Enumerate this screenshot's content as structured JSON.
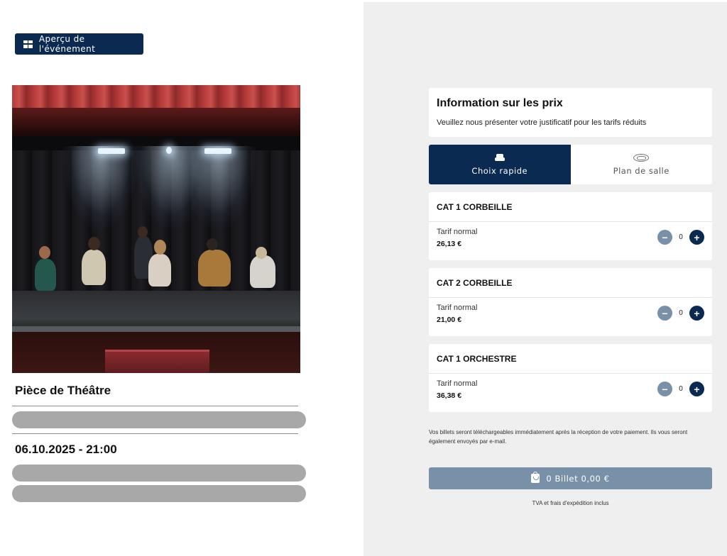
{
  "event": {
    "preview_button_label": "Aperçu de l'événement",
    "title": "Pièce de Théâtre",
    "datetime": "06.10.2025 - 21:00"
  },
  "pricing": {
    "title": "Information sur les prix",
    "subtitle": "Veuillez nous présenter votre justificatif pour les tarifs réduits"
  },
  "tabs": [
    {
      "label": "Choix rapide",
      "icon": "seat-icon",
      "active": true
    },
    {
      "label": "Plan de salle",
      "icon": "seating-plan-icon",
      "active": false
    }
  ],
  "categories": [
    {
      "name": "CAT 1 CORBEILLE",
      "tariff": "Tarif normal",
      "price": "26,13 €",
      "quantity": "0"
    },
    {
      "name": "CAT 2 CORBEILLE",
      "tariff": "Tarif normal",
      "price": "21,00 €",
      "quantity": "0"
    },
    {
      "name": "CAT 1 ORCHESTRE",
      "tariff": "Tarif normal",
      "price": "36,38 €",
      "quantity": "0"
    }
  ],
  "notice": "Vos billets seront téléchargeables immédiatement après la réception de votre paiement. Ils vous seront également envoyés par e-mail.",
  "cart": {
    "label": "0 Billet 0,00 €",
    "icon": "shopping-bag-icon"
  },
  "tax_note": "TVA et frais d'expédition inclus",
  "colors": {
    "primary": "#0a2a52",
    "disabled": "#7890a8",
    "panel_bg": "#efeff0",
    "placeholder": "#a8a8a8"
  }
}
